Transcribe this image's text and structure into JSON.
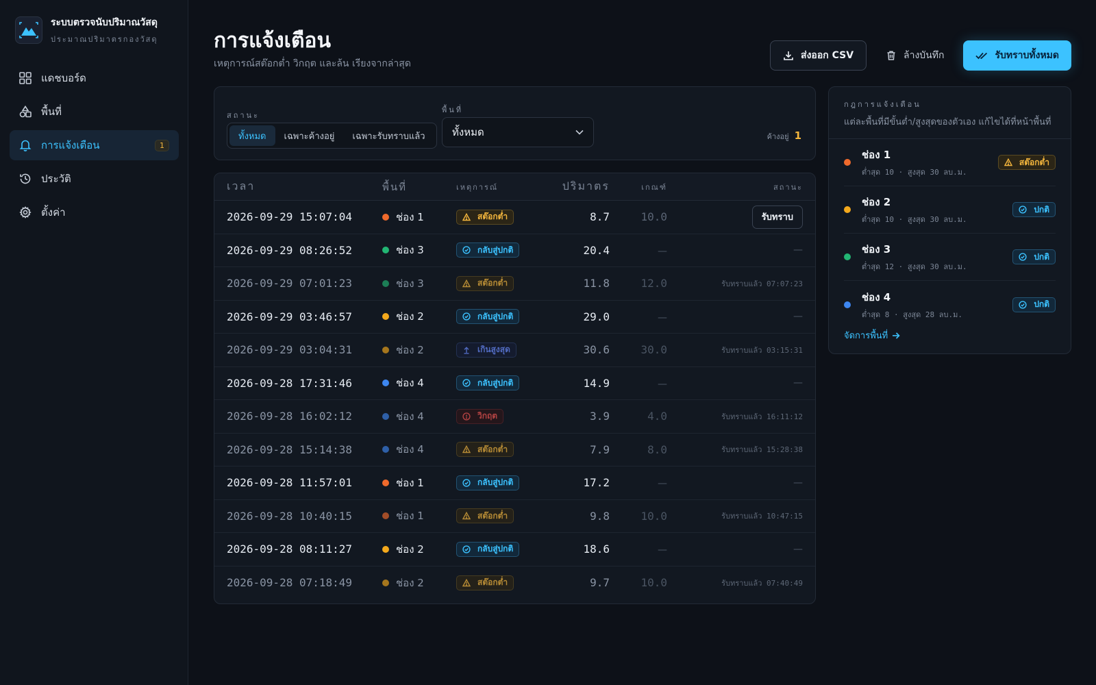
{
  "brand": {
    "title": "ระบบตรวจนับปริมาณวัสดุ",
    "subtitle": "ประมาณปริมาตรกองวัสดุ"
  },
  "nav": [
    {
      "label": "แดชบอร์ด",
      "icon": "grid-icon"
    },
    {
      "label": "พื้นที่",
      "icon": "shapes-icon"
    },
    {
      "label": "การแจ้งเตือน",
      "icon": "bell-icon",
      "badge": "1",
      "active": true
    },
    {
      "label": "ประวัติ",
      "icon": "history-icon"
    },
    {
      "label": "ตั้งค่า",
      "icon": "gear-icon"
    }
  ],
  "header": {
    "title": "การแจ้งเตือน",
    "subtitle": "เหตุการณ์สต๊อกต่ำ วิกฤต และล้น เรียงจากล่าสุด",
    "export_label": "ส่งออก CSV",
    "clear_label": "ล้างบันทึก",
    "ack_all_label": "รับทราบทั้งหมด"
  },
  "filters": {
    "status_label": "สถานะ",
    "status_options": [
      "ทั้งหมด",
      "เฉพาะค้างอยู่",
      "เฉพาะรับทราบแล้ว"
    ],
    "area_label": "พื้นที่",
    "area_value": "ทั้งหมด",
    "pending_label": "ค้างอยู่",
    "pending_count": "1"
  },
  "table": {
    "headers": [
      "เวลา",
      "พื้นที่",
      "เหตุการณ์",
      "ปริมาตร",
      "เกณฑ์",
      "สถานะ"
    ],
    "rows": [
      {
        "time": "2026-09-29 15:07:04",
        "area": "ช่อง 1",
        "dot": "#f06a2c",
        "event": "สต๊อกต่ำ",
        "type": "low",
        "qty": "8.7",
        "threshold": "10.0",
        "status": "รับทราบ",
        "status_kind": "button",
        "dim": false
      },
      {
        "time": "2026-09-29 08:26:52",
        "area": "ช่อง 3",
        "dot": "#22b573",
        "event": "กลับสู่ปกติ",
        "type": "ok",
        "qty": "20.4",
        "threshold": "—",
        "status": "—",
        "status_kind": "dash",
        "dim": false
      },
      {
        "time": "2026-09-29 07:01:23",
        "area": "ช่อง 3",
        "dot": "#22b573",
        "event": "สต๊อกต่ำ",
        "type": "low",
        "qty": "11.8",
        "threshold": "12.0",
        "status": "รับทราบแล้ว 07:07:23",
        "status_kind": "text",
        "dim": true
      },
      {
        "time": "2026-09-29 03:46:57",
        "area": "ช่อง 2",
        "dot": "#f4a91c",
        "event": "กลับสู่ปกติ",
        "type": "ok",
        "qty": "29.0",
        "threshold": "—",
        "status": "—",
        "status_kind": "dash",
        "dim": false
      },
      {
        "time": "2026-09-29 03:04:31",
        "area": "ช่อง 2",
        "dot": "#f4a91c",
        "event": "เกินสูงสุด",
        "type": "over",
        "qty": "30.6",
        "threshold": "30.0",
        "status": "รับทราบแล้ว 03:15:31",
        "status_kind": "text",
        "dim": true
      },
      {
        "time": "2026-09-28 17:31:46",
        "area": "ช่อง 4",
        "dot": "#3d86f0",
        "event": "กลับสู่ปกติ",
        "type": "ok",
        "qty": "14.9",
        "threshold": "—",
        "status": "—",
        "status_kind": "dash",
        "dim": false
      },
      {
        "time": "2026-09-28 16:02:12",
        "area": "ช่อง 4",
        "dot": "#3d86f0",
        "event": "วิกฤต",
        "type": "crit",
        "qty": "3.9",
        "threshold": "4.0",
        "status": "รับทราบแล้ว 16:11:12",
        "status_kind": "text",
        "dim": true
      },
      {
        "time": "2026-09-28 15:14:38",
        "area": "ช่อง 4",
        "dot": "#3d86f0",
        "event": "สต๊อกต่ำ",
        "type": "low",
        "qty": "7.9",
        "threshold": "8.0",
        "status": "รับทราบแล้ว 15:28:38",
        "status_kind": "text",
        "dim": true
      },
      {
        "time": "2026-09-28 11:57:01",
        "area": "ช่อง 1",
        "dot": "#f06a2c",
        "event": "กลับสู่ปกติ",
        "type": "ok",
        "qty": "17.2",
        "threshold": "—",
        "status": "—",
        "status_kind": "dash",
        "dim": false
      },
      {
        "time": "2026-09-28 10:40:15",
        "area": "ช่อง 1",
        "dot": "#f06a2c",
        "event": "สต๊อกต่ำ",
        "type": "low",
        "qty": "9.8",
        "threshold": "10.0",
        "status": "รับทราบแล้ว 10:47:15",
        "status_kind": "text",
        "dim": true
      },
      {
        "time": "2026-09-28 08:11:27",
        "area": "ช่อง 2",
        "dot": "#f4a91c",
        "event": "กลับสู่ปกติ",
        "type": "ok",
        "qty": "18.6",
        "threshold": "—",
        "status": "—",
        "status_kind": "dash",
        "dim": false
      },
      {
        "time": "2026-09-28 07:18:49",
        "area": "ช่อง 2",
        "dot": "#f4a91c",
        "event": "สต๊อกต่ำ",
        "type": "low",
        "qty": "9.7",
        "threshold": "10.0",
        "status": "รับทราบแล้ว 07:40:49",
        "status_kind": "text",
        "dim": true
      }
    ]
  },
  "rules": {
    "title": "กฎการแจ้งเตือน",
    "subtitle": "แต่ละพื้นที่มีขั้นต่ำ/สูงสุดของตัวเอง แก้ไขได้ที่หน้าพื้นที่",
    "items": [
      {
        "name": "ช่อง 1",
        "dot": "#f06a2c",
        "detail": "ต่ำสุด 10 · สูงสุด 30 ลบ.ม.",
        "status": "สต๊อกต่ำ",
        "type": "low"
      },
      {
        "name": "ช่อง 2",
        "dot": "#f4a91c",
        "detail": "ต่ำสุด 10 · สูงสุด 30 ลบ.ม.",
        "status": "ปกติ",
        "type": "ok"
      },
      {
        "name": "ช่อง 3",
        "dot": "#22b573",
        "detail": "ต่ำสุด 12 · สูงสุด 30 ลบ.ม.",
        "status": "ปกติ",
        "type": "ok"
      },
      {
        "name": "ช่อง 4",
        "dot": "#3d86f0",
        "detail": "ต่ำสุด 8 · สูงสุด 28 ลบ.ม.",
        "status": "ปกติ",
        "type": "ok"
      }
    ],
    "manage_label": "จัดการพื้นที่"
  },
  "colors": {
    "accent": "#3cc2ff",
    "warning": "#f4b63d",
    "critical": "#ef5350",
    "over": "#6a8cff"
  }
}
